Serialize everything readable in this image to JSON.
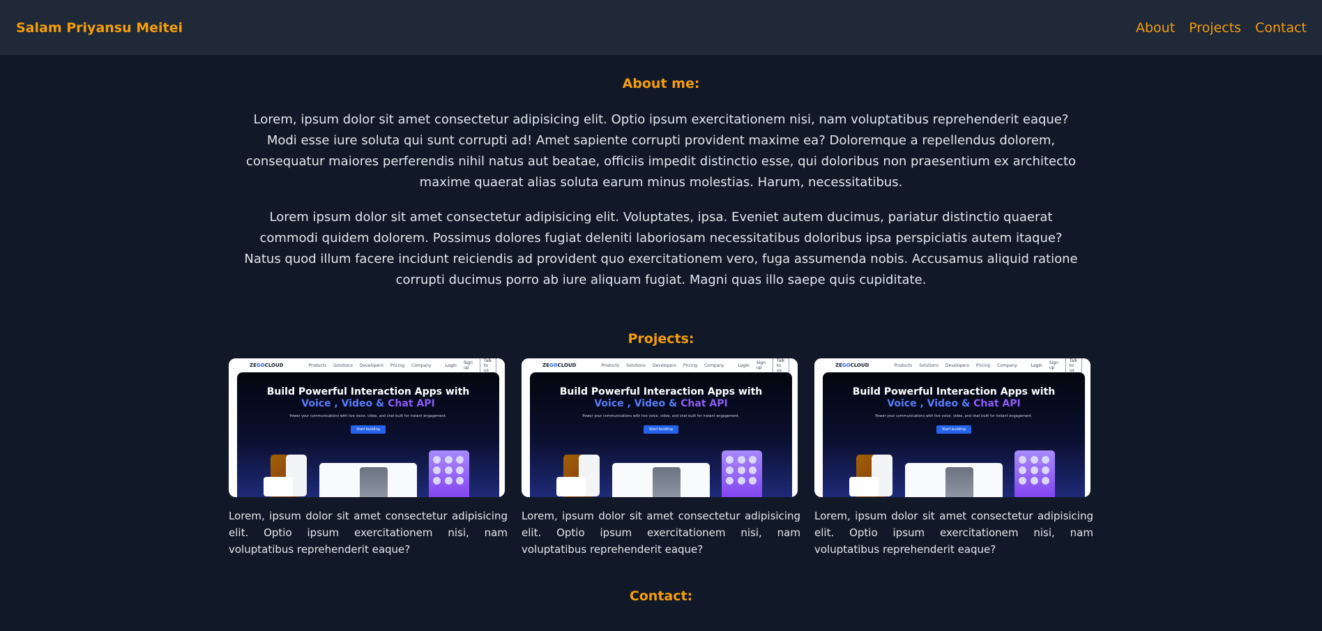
{
  "header": {
    "brand": "Salam Priyansu Meitei",
    "nav": [
      "About",
      "Projects",
      "Contact"
    ]
  },
  "about": {
    "title": "About me:",
    "paragraphs": [
      "Lorem, ipsum dolor sit amet consectetur adipisicing elit. Optio ipsum exercitationem nisi, nam voluptatibus reprehenderit eaque? Modi esse iure soluta qui sunt corrupti ad! Amet sapiente corrupti provident maxime ea? Doloremque a repellendus dolorem, consequatur maiores perferendis nihil natus aut beatae, officiis impedit distinctio esse, qui doloribus non praesentium ex architecto maxime quaerat alias soluta earum minus molestias. Harum, necessitatibus.",
      "Lorem ipsum dolor sit amet consectetur adipisicing elit. Voluptates, ipsa. Eveniet autem ducimus, pariatur distinctio quaerat commodi quidem dolorem. Possimus dolores fugiat deleniti laboriosam necessitatibus doloribus ipsa perspiciatis autem itaque? Natus quod illum facere incidunt reiciendis ad provident quo exercitationem vero, fuga assumenda nobis. Accusamus aliquid ratione corrupti ducimus porro ab iure aliquam fugiat. Magni quas illo saepe quis cupiditate."
    ]
  },
  "projects": {
    "title": "Projects:",
    "thumbnail": {
      "logo_a": "ZE",
      "logo_b": "GO",
      "logo_c": "CLOUD",
      "menu": [
        "Products",
        "Solutions",
        "Developers",
        "Pricing",
        "Company"
      ],
      "login": "Login",
      "signup": "Sign up",
      "talk": "Talk to us",
      "heading_line1": "Build Powerful Interaction Apps with",
      "heading_line2a": "Voice , Video & ",
      "heading_line2b": "Chat API",
      "subheading": "Power your communications with live voice, video, and chat built for instant engagement.",
      "cta": "Start building"
    },
    "items": [
      {
        "description": "Lorem, ipsum dolor sit amet consectetur adipisicing elit. Optio ipsum exercitationem nisi, nam voluptatibus reprehenderit eaque?"
      },
      {
        "description": "Lorem, ipsum dolor sit amet consectetur adipisicing elit. Optio ipsum exercitationem nisi, nam voluptatibus reprehenderit eaque?"
      },
      {
        "description": "Lorem, ipsum dolor sit amet consectetur adipisicing elit. Optio ipsum exercitationem nisi, nam voluptatibus reprehenderit eaque?"
      }
    ]
  },
  "contact": {
    "title": "Contact:"
  },
  "colors": {
    "background": "#111827",
    "navbar": "#1f2937",
    "accent": "#f59e0b",
    "text": "#e5e7eb"
  }
}
